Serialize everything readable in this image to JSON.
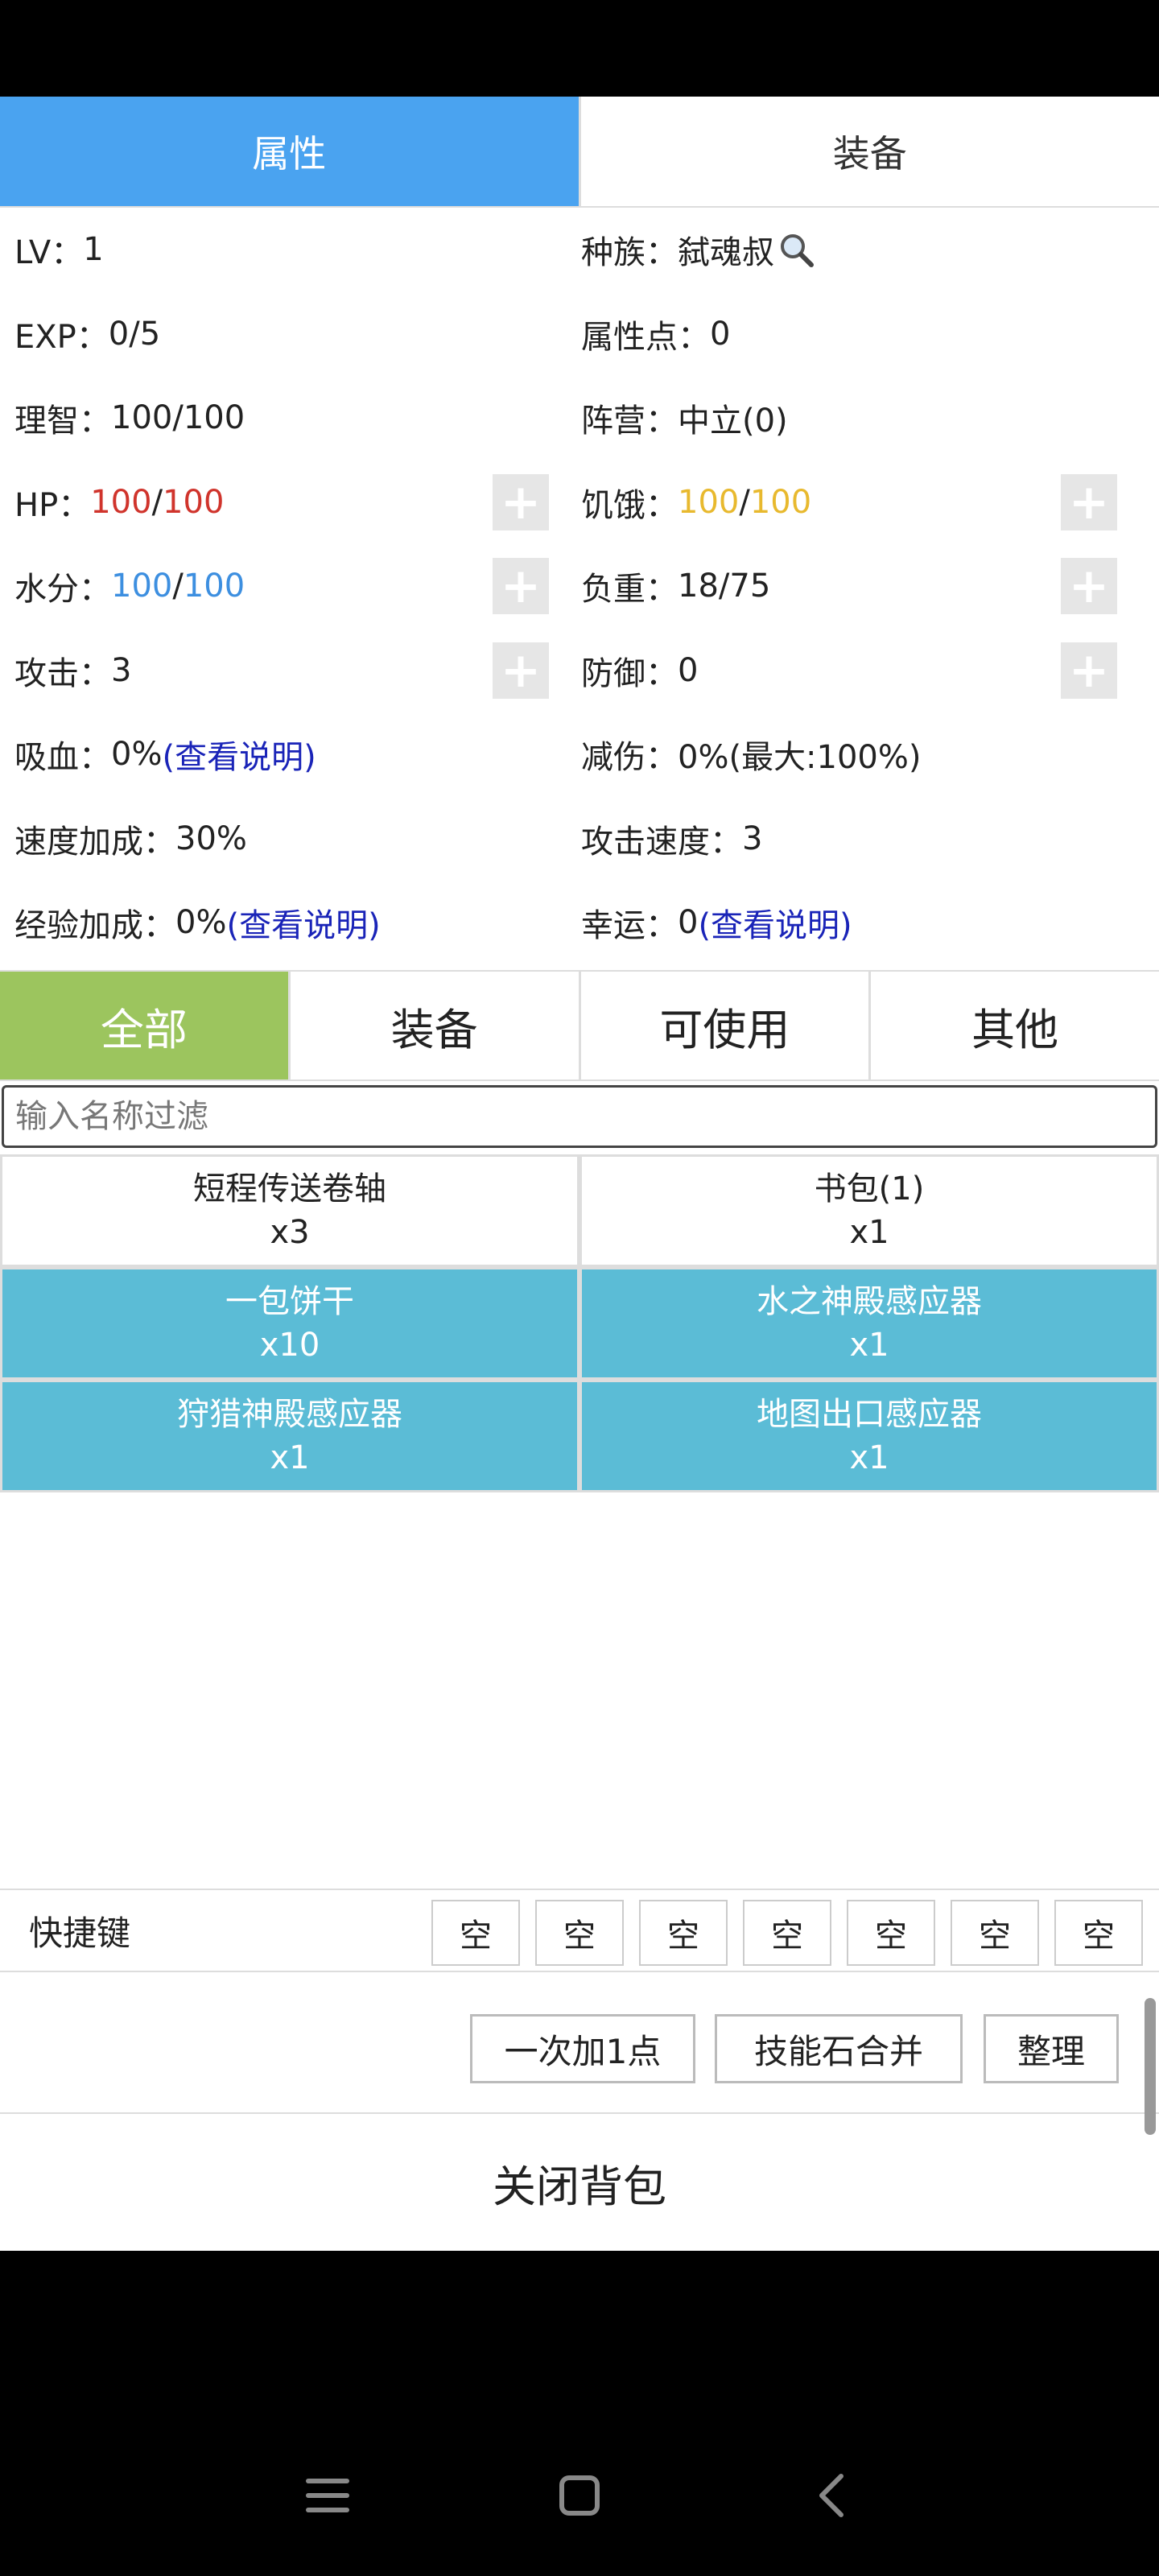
{
  "top_tabs": [
    {
      "label": "属性",
      "active": true
    },
    {
      "label": "装备",
      "active": false
    }
  ],
  "stats": {
    "lv": {
      "label": "LV：",
      "value": "1"
    },
    "race": {
      "label": "种族：",
      "value": "弑魂叔",
      "icon": "search-icon"
    },
    "exp": {
      "label": "EXP：",
      "value": "0/5"
    },
    "attr_points": {
      "label": "属性点：",
      "value": "0"
    },
    "sanity": {
      "label": "理智：",
      "value": "100/100"
    },
    "faction": {
      "label": "阵营：",
      "value": "中立(0)"
    },
    "hp": {
      "label": "HP：",
      "current": "100",
      "sep": "/",
      "max": "100",
      "color": "#d0342c"
    },
    "hunger": {
      "label": "饥饿：",
      "current": "100",
      "sep": "/",
      "max": "100",
      "color": "#e8b92e"
    },
    "water": {
      "label": "水分：",
      "current": "100",
      "sep": "/",
      "max": "100",
      "color": "#3d8fe0"
    },
    "weight": {
      "label": "负重：",
      "value": "18/75"
    },
    "attack": {
      "label": "攻击：",
      "value": "3"
    },
    "defense": {
      "label": "防御：",
      "value": "0"
    },
    "lifesteal": {
      "label": "吸血：",
      "value": "0%",
      "link": "(查看说明)"
    },
    "damage_reduction": {
      "label": "减伤：",
      "value": "0%(最大:100%)"
    },
    "speed_bonus": {
      "label": "速度加成：",
      "value": "30%"
    },
    "attack_speed": {
      "label": "攻击速度：",
      "value": "3"
    },
    "exp_bonus": {
      "label": "经验加成：",
      "value": "0%",
      "link": "(查看说明)"
    },
    "luck": {
      "label": "幸运：",
      "value": "0",
      "link": "(查看说明)"
    },
    "plus_symbol": "+"
  },
  "category_tabs": [
    {
      "label": "全部",
      "active": true
    },
    {
      "label": "装备",
      "active": false
    },
    {
      "label": "可使用",
      "active": false
    },
    {
      "label": "其他",
      "active": false
    }
  ],
  "filter": {
    "placeholder": "输入名称过滤",
    "value": ""
  },
  "items": [
    {
      "name": "短程传送卷轴",
      "count": "x3",
      "highlight": false
    },
    {
      "name": "书包(1)",
      "count": "x1",
      "highlight": false
    },
    {
      "name": "一包饼干",
      "count": "x10",
      "highlight": true
    },
    {
      "name": "水之神殿感应器",
      "count": "x1",
      "highlight": true
    },
    {
      "name": "狩猎神殿感应器",
      "count": "x1",
      "highlight": true
    },
    {
      "name": "地图出口感应器",
      "count": "x1",
      "highlight": true
    }
  ],
  "hotkeys": {
    "label": "快捷键",
    "slots": [
      "空",
      "空",
      "空",
      "空",
      "空",
      "空",
      "空"
    ]
  },
  "actions": {
    "add_one": "一次加1点",
    "merge_stones": "技能石合并",
    "sort": "整理"
  },
  "close_label": "关闭背包",
  "colors": {
    "tab_active": "#4aa3f0",
    "category_active": "#9cc55e",
    "item_highlight": "#5bbcd6",
    "link": "#1a24b8"
  },
  "navbar": {
    "icons": [
      "menu-icon",
      "home-icon",
      "back-icon"
    ]
  }
}
